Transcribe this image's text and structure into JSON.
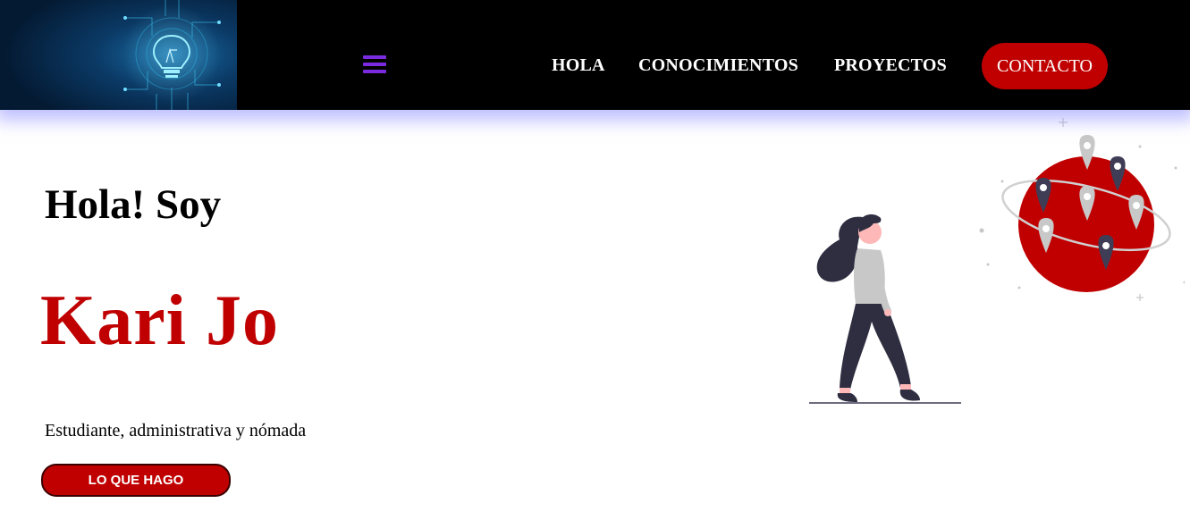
{
  "header": {
    "logo_icon": "lightbulb-circuit-icon",
    "menu_icon": "hamburger-menu-icon",
    "nav": [
      {
        "label": "HOLA"
      },
      {
        "label": "CONOCIMIENTOS"
      },
      {
        "label": "PROYECTOS"
      }
    ],
    "contact_label": "CONTACTO"
  },
  "hero": {
    "greeting": "Hola! Soy",
    "name": "Kari Jo",
    "subtitle": "Estudiante, administrativa y nómada",
    "cta_label": "LO QUE HAGO"
  },
  "colors": {
    "accent": "#c00000",
    "header_bg": "#000000",
    "menu_icon": "#7a2be0",
    "header_glow": "#8c8cff"
  },
  "illustration": {
    "icon": "woman-walking-globe-pins-illustration"
  }
}
